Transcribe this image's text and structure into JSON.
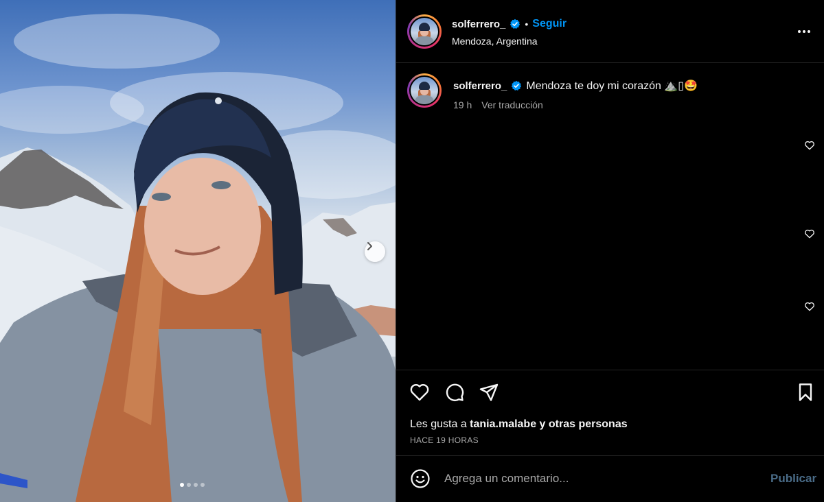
{
  "post": {
    "carousel": {
      "next_icon": "chevron-right-icon",
      "slide_count": 4,
      "active_slide": 1
    }
  },
  "header": {
    "username": "solferrero_",
    "verified_icon": "verified-badge-icon",
    "separator": "•",
    "follow_label": "Seguir",
    "location": "Mendoza, Argentina",
    "more_icon": "more-options-icon"
  },
  "caption": {
    "username": "solferrero_",
    "text": "Mendoza te doy mi corazón ⛰️▯🤩",
    "time": "19 h",
    "translate_label": "Ver traducción"
  },
  "actions": {
    "like_icon": "heart-icon",
    "comment_icon": "comment-icon",
    "share_icon": "send-icon",
    "save_icon": "bookmark-icon"
  },
  "likes": {
    "prefix": "Les gusta a ",
    "user": "tania.malabe",
    "suffix": " y otras personas"
  },
  "time_ago": "HACE 19 HORAS",
  "comment_box": {
    "emoji_icon": "emoji-icon",
    "placeholder": "Agrega un comentario...",
    "publish_label": "Publicar"
  },
  "colors": {
    "background": "#000000",
    "accent": "#0095f6",
    "muted_text": "#a8a8a8",
    "publish_disabled": "#4a6c88"
  }
}
